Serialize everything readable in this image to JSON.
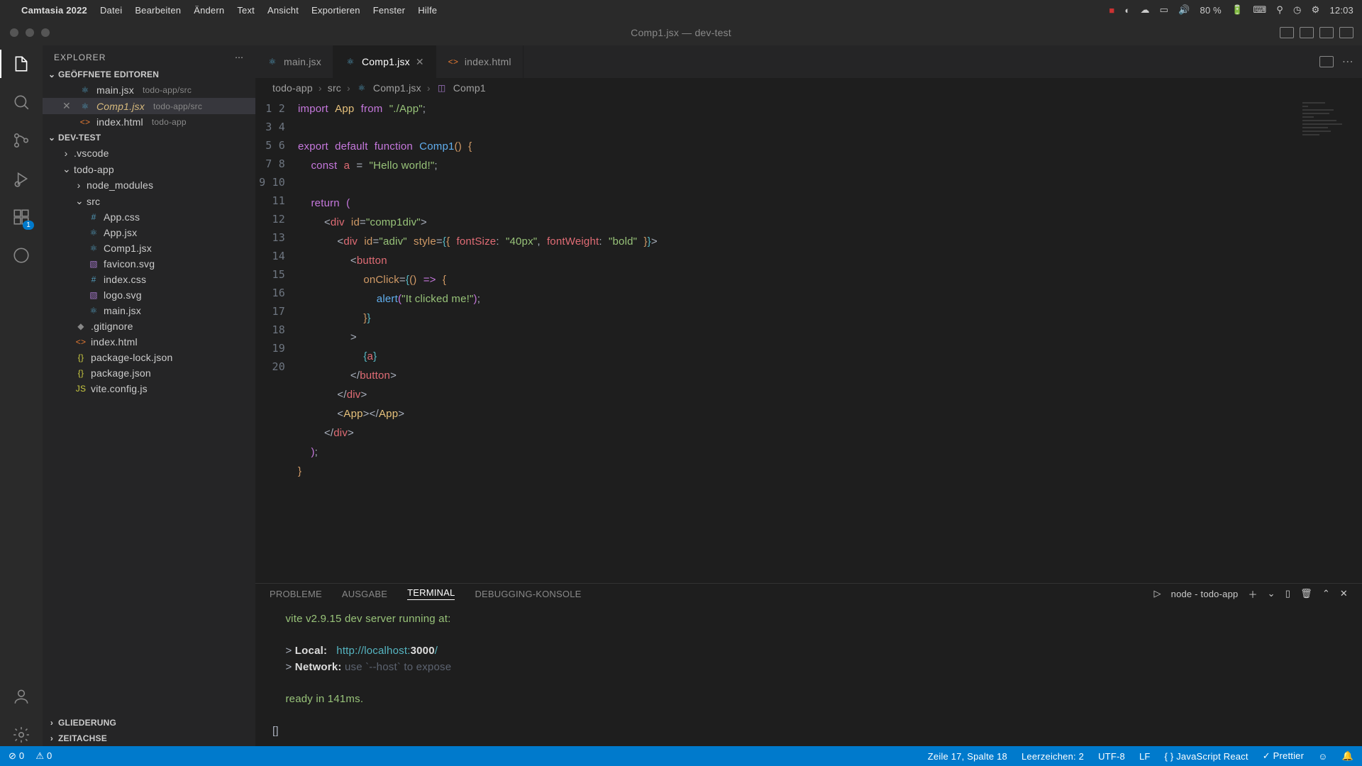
{
  "menubar": {
    "app": "Camtasia 2022",
    "items": [
      "Datei",
      "Bearbeiten",
      "Ändern",
      "Text",
      "Ansicht",
      "Exportieren",
      "Fenster",
      "Hilfe"
    ],
    "battery": "80 %",
    "clock": "12:03"
  },
  "window": {
    "title": "Comp1.jsx — dev-test"
  },
  "activitybar": {
    "badge": "1"
  },
  "explorer": {
    "title": "EXPLORER",
    "openEditorsLabel": "GEÖFFNETE EDITOREN",
    "openEditors": [
      {
        "name": "main.jsx",
        "path": "todo-app/src"
      },
      {
        "name": "Comp1.jsx",
        "path": "todo-app/src",
        "active": true
      },
      {
        "name": "index.html",
        "path": "todo-app"
      }
    ],
    "projectLabel": "DEV-TEST",
    "tree": {
      "vscode": ".vscode",
      "todoapp": "todo-app",
      "node_modules": "node_modules",
      "src": "src",
      "files_src": [
        "App.css",
        "App.jsx",
        "Comp1.jsx",
        "favicon.svg",
        "index.css",
        "logo.svg",
        "main.jsx"
      ],
      "gitignore": ".gitignore",
      "indexhtml": "index.html",
      "pkglock": "package-lock.json",
      "pkg": "package.json",
      "vite": "vite.config.js"
    },
    "gliederung": "GLIEDERUNG",
    "zeitachse": "ZEITACHSE"
  },
  "tabs": [
    {
      "name": "main.jsx"
    },
    {
      "name": "Comp1.jsx",
      "active": true
    },
    {
      "name": "index.html"
    }
  ],
  "breadcrumb": [
    "todo-app",
    "src",
    "Comp1.jsx",
    "Comp1"
  ],
  "code": {
    "lineCount": 20,
    "lines": {
      "l1_import": "import",
      "l1_app": "App",
      "l1_from": "from",
      "l1_str": "\"./App\"",
      "l3_export": "export",
      "l3_default": "default",
      "l3_function": "function",
      "l3_name": "Comp1",
      "l4_const": "const",
      "l4_var": "a",
      "l4_str": "\"Hello world!\"",
      "l6_return": "return",
      "l7_div": "div",
      "l7_id": "id",
      "l7_val": "\"comp1div\"",
      "l8_div": "div",
      "l8_id": "id",
      "l8_idval": "\"adiv\"",
      "l8_style": "style",
      "l8_fs": "fontSize",
      "l8_fsv": "\"40px\"",
      "l8_fw": "fontWeight",
      "l8_fwv": "\"bold\"",
      "l9_button": "button",
      "l10_onclick": "onClick",
      "l11_alert": "alert",
      "l11_str": "\"It clicked me!\"",
      "l13_gt": ">",
      "l14_a": "a",
      "l15_button": "button",
      "l16_div": "div",
      "l17_app": "App",
      "l18_div": "div"
    }
  },
  "panel": {
    "tabs": [
      "PROBLEME",
      "AUSGABE",
      "TERMINAL",
      "DEBUGGING-KONSOLE"
    ],
    "termLabel": "node - todo-app",
    "term": {
      "l1a": "vite v2.9.15",
      "l1b": " dev server running at:",
      "l2a": "> ",
      "l2b": "Local:",
      "l2c": "   http://localhost:",
      "l2d": "3000",
      "l2e": "/",
      "l3a": "> ",
      "l3b": "Network:",
      "l3c": " use `--host` to expose",
      "l4": "ready in 141ms.",
      "prompt": "[]"
    }
  },
  "status": {
    "errors": "0",
    "warnings": "0",
    "pos": "Zeile 17, Spalte 18",
    "spaces": "Leerzeichen: 2",
    "enc": "UTF-8",
    "eol": "LF",
    "lang": "JavaScript React",
    "prettier": "Prettier"
  }
}
